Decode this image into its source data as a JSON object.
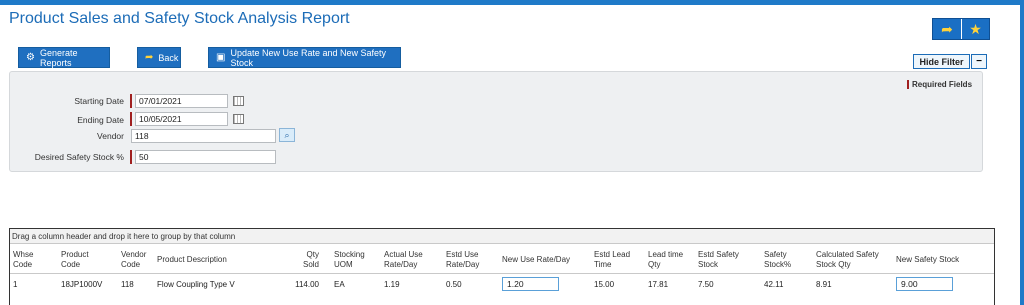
{
  "title": "Product Sales and Safety Stock Analysis Report",
  "toolbar": {
    "generate_label": "Generate Reports",
    "back_label": "Back",
    "update_label": "Update New Use Rate and New Safety Stock",
    "hide_filter_label": "Hide Filter",
    "collapse_label": "−"
  },
  "required_label": "Required Fields",
  "filters": {
    "starting_date": {
      "label": "Starting Date",
      "value": "07/01/2021"
    },
    "ending_date": {
      "label": "Ending Date",
      "value": "10/05/2021"
    },
    "vendor": {
      "label": "Vendor",
      "value": "118"
    },
    "safety_stock": {
      "label": "Desired Safety Stock %",
      "value": "50"
    }
  },
  "grid": {
    "group_hint": "Drag a column header and drop it here to group by that column",
    "headers": {
      "whse": "Whse Code",
      "product": "Product Code",
      "vendor": "Vendor Code",
      "desc": "Product Description",
      "qty": "Qty Sold",
      "uom": "Stocking UOM",
      "actual": "Actual Use Rate/Day",
      "estd_use": "Estd Use Rate/Day",
      "new_use": "New Use Rate/Day",
      "estd_lead": "Estd Lead Time",
      "lead_qty": "Lead time Qty",
      "estd_safety": "Estd Safety Stock",
      "safety_pct": "Safety Stock%",
      "calc_safety": "Calculated Safety Stock Qty",
      "new_safety": "New Safety Stock"
    },
    "row": {
      "whse": "1",
      "product": "18JP1000V",
      "vendor": "118",
      "desc": "Flow Coupling Type V",
      "qty": "114.00",
      "uom": "EA",
      "actual": "1.19",
      "estd_use": "0.50",
      "new_use": "1.20",
      "estd_lead": "15.00",
      "lead_qty": "17.81",
      "estd_safety": "7.50",
      "safety_pct": "42.11",
      "calc_safety": "8.91",
      "new_safety": "9.00"
    }
  },
  "icons": {
    "back": "back-arrow-icon",
    "favorite": "star-icon",
    "generate": "report-gear-icon",
    "update": "save-icon",
    "calendar": "calendar-icon",
    "search": "search-icon"
  },
  "colors": {
    "accent": "#1f6fc0",
    "required": "#a02020",
    "star": "#ffd23a"
  }
}
